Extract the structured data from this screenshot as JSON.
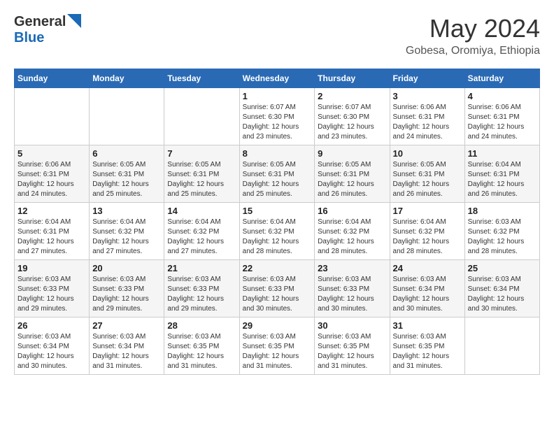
{
  "header": {
    "logo_general": "General",
    "logo_blue": "Blue",
    "month_year": "May 2024",
    "location": "Gobesa, Oromiya, Ethiopia"
  },
  "calendar": {
    "days_of_week": [
      "Sunday",
      "Monday",
      "Tuesday",
      "Wednesday",
      "Thursday",
      "Friday",
      "Saturday"
    ],
    "weeks": [
      [
        {
          "day": "",
          "info": ""
        },
        {
          "day": "",
          "info": ""
        },
        {
          "day": "",
          "info": ""
        },
        {
          "day": "1",
          "info": "Sunrise: 6:07 AM\nSunset: 6:30 PM\nDaylight: 12 hours\nand 23 minutes."
        },
        {
          "day": "2",
          "info": "Sunrise: 6:07 AM\nSunset: 6:30 PM\nDaylight: 12 hours\nand 23 minutes."
        },
        {
          "day": "3",
          "info": "Sunrise: 6:06 AM\nSunset: 6:31 PM\nDaylight: 12 hours\nand 24 minutes."
        },
        {
          "day": "4",
          "info": "Sunrise: 6:06 AM\nSunset: 6:31 PM\nDaylight: 12 hours\nand 24 minutes."
        }
      ],
      [
        {
          "day": "5",
          "info": "Sunrise: 6:06 AM\nSunset: 6:31 PM\nDaylight: 12 hours\nand 24 minutes."
        },
        {
          "day": "6",
          "info": "Sunrise: 6:05 AM\nSunset: 6:31 PM\nDaylight: 12 hours\nand 25 minutes."
        },
        {
          "day": "7",
          "info": "Sunrise: 6:05 AM\nSunset: 6:31 PM\nDaylight: 12 hours\nand 25 minutes."
        },
        {
          "day": "8",
          "info": "Sunrise: 6:05 AM\nSunset: 6:31 PM\nDaylight: 12 hours\nand 25 minutes."
        },
        {
          "day": "9",
          "info": "Sunrise: 6:05 AM\nSunset: 6:31 PM\nDaylight: 12 hours\nand 26 minutes."
        },
        {
          "day": "10",
          "info": "Sunrise: 6:05 AM\nSunset: 6:31 PM\nDaylight: 12 hours\nand 26 minutes."
        },
        {
          "day": "11",
          "info": "Sunrise: 6:04 AM\nSunset: 6:31 PM\nDaylight: 12 hours\nand 26 minutes."
        }
      ],
      [
        {
          "day": "12",
          "info": "Sunrise: 6:04 AM\nSunset: 6:31 PM\nDaylight: 12 hours\nand 27 minutes."
        },
        {
          "day": "13",
          "info": "Sunrise: 6:04 AM\nSunset: 6:32 PM\nDaylight: 12 hours\nand 27 minutes."
        },
        {
          "day": "14",
          "info": "Sunrise: 6:04 AM\nSunset: 6:32 PM\nDaylight: 12 hours\nand 27 minutes."
        },
        {
          "day": "15",
          "info": "Sunrise: 6:04 AM\nSunset: 6:32 PM\nDaylight: 12 hours\nand 28 minutes."
        },
        {
          "day": "16",
          "info": "Sunrise: 6:04 AM\nSunset: 6:32 PM\nDaylight: 12 hours\nand 28 minutes."
        },
        {
          "day": "17",
          "info": "Sunrise: 6:04 AM\nSunset: 6:32 PM\nDaylight: 12 hours\nand 28 minutes."
        },
        {
          "day": "18",
          "info": "Sunrise: 6:03 AM\nSunset: 6:32 PM\nDaylight: 12 hours\nand 28 minutes."
        }
      ],
      [
        {
          "day": "19",
          "info": "Sunrise: 6:03 AM\nSunset: 6:33 PM\nDaylight: 12 hours\nand 29 minutes."
        },
        {
          "day": "20",
          "info": "Sunrise: 6:03 AM\nSunset: 6:33 PM\nDaylight: 12 hours\nand 29 minutes."
        },
        {
          "day": "21",
          "info": "Sunrise: 6:03 AM\nSunset: 6:33 PM\nDaylight: 12 hours\nand 29 minutes."
        },
        {
          "day": "22",
          "info": "Sunrise: 6:03 AM\nSunset: 6:33 PM\nDaylight: 12 hours\nand 30 minutes."
        },
        {
          "day": "23",
          "info": "Sunrise: 6:03 AM\nSunset: 6:33 PM\nDaylight: 12 hours\nand 30 minutes."
        },
        {
          "day": "24",
          "info": "Sunrise: 6:03 AM\nSunset: 6:34 PM\nDaylight: 12 hours\nand 30 minutes."
        },
        {
          "day": "25",
          "info": "Sunrise: 6:03 AM\nSunset: 6:34 PM\nDaylight: 12 hours\nand 30 minutes."
        }
      ],
      [
        {
          "day": "26",
          "info": "Sunrise: 6:03 AM\nSunset: 6:34 PM\nDaylight: 12 hours\nand 30 minutes."
        },
        {
          "day": "27",
          "info": "Sunrise: 6:03 AM\nSunset: 6:34 PM\nDaylight: 12 hours\nand 31 minutes."
        },
        {
          "day": "28",
          "info": "Sunrise: 6:03 AM\nSunset: 6:35 PM\nDaylight: 12 hours\nand 31 minutes."
        },
        {
          "day": "29",
          "info": "Sunrise: 6:03 AM\nSunset: 6:35 PM\nDaylight: 12 hours\nand 31 minutes."
        },
        {
          "day": "30",
          "info": "Sunrise: 6:03 AM\nSunset: 6:35 PM\nDaylight: 12 hours\nand 31 minutes."
        },
        {
          "day": "31",
          "info": "Sunrise: 6:03 AM\nSunset: 6:35 PM\nDaylight: 12 hours\nand 31 minutes."
        },
        {
          "day": "",
          "info": ""
        }
      ]
    ]
  }
}
